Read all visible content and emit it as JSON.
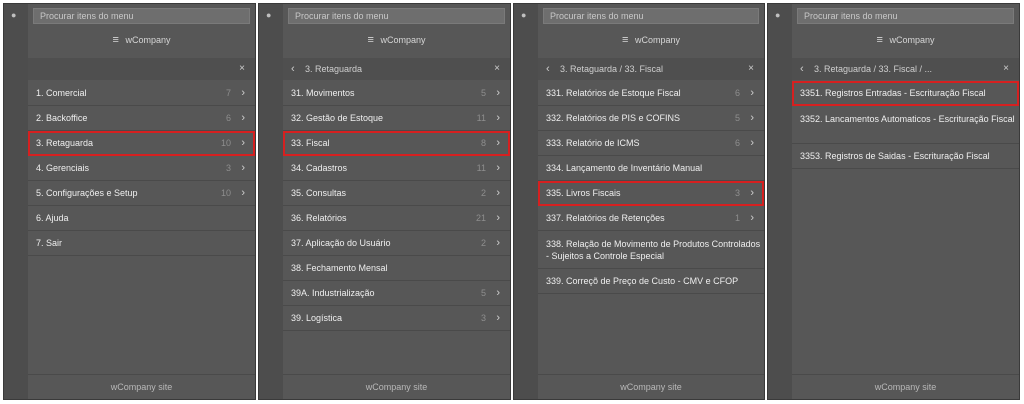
{
  "panels": [
    {
      "search_placeholder": "Procurar itens do menu",
      "title": "wCompany",
      "breadcrumb": "",
      "items": [
        {
          "label": "1. Comercial",
          "count": "7",
          "has_arrow": true
        },
        {
          "label": "2. Backoffice",
          "count": "6",
          "has_arrow": true
        },
        {
          "label": "3. Retaguarda",
          "count": "10",
          "has_arrow": true,
          "highlighted": true
        },
        {
          "label": "4. Gerenciais",
          "count": "3",
          "has_arrow": true
        },
        {
          "label": "5. Configurações e Setup",
          "count": "10",
          "has_arrow": true
        },
        {
          "label": "6. Ajuda",
          "count": "",
          "has_arrow": false
        },
        {
          "label": "7. Sair",
          "count": "",
          "has_arrow": false
        }
      ],
      "footer": "wCompany site"
    },
    {
      "search_placeholder": "Procurar itens do menu",
      "title": "wCompany",
      "breadcrumb": "3. Retaguarda",
      "items": [
        {
          "label": "31. Movimentos",
          "count": "5",
          "has_arrow": true
        },
        {
          "label": "32. Gestão de Estoque",
          "count": "11",
          "has_arrow": true
        },
        {
          "label": "33. Fiscal",
          "count": "8",
          "has_arrow": true,
          "highlighted": true
        },
        {
          "label": "34. Cadastros",
          "count": "11",
          "has_arrow": true
        },
        {
          "label": "35. Consultas",
          "count": "2",
          "has_arrow": true
        },
        {
          "label": "36. Relatórios",
          "count": "21",
          "has_arrow": true
        },
        {
          "label": "37. Aplicação do Usuário",
          "count": "2",
          "has_arrow": true
        },
        {
          "label": "38. Fechamento Mensal",
          "count": "",
          "has_arrow": false
        },
        {
          "label": "39A. Industrialização",
          "count": "5",
          "has_arrow": true
        },
        {
          "label": "39. Logística",
          "count": "3",
          "has_arrow": true
        }
      ],
      "footer": "wCompany site"
    },
    {
      "search_placeholder": "Procurar itens do menu",
      "title": "wCompany",
      "breadcrumb": "3. Retaguarda / 33. Fiscal",
      "items": [
        {
          "label": "331. Relatórios de Estoque Fiscal",
          "count": "6",
          "has_arrow": true
        },
        {
          "label": "332. Relatórios de PIS e COFINS",
          "count": "5",
          "has_arrow": true
        },
        {
          "label": "333. Relatório de ICMS",
          "count": "6",
          "has_arrow": true
        },
        {
          "label": "334. Lançamento de Inventário Manual",
          "count": "",
          "has_arrow": false
        },
        {
          "label": "335. Livros Fiscais",
          "count": "3",
          "has_arrow": true,
          "highlighted": true
        },
        {
          "label": "337. Relatórios de Retenções",
          "count": "1",
          "has_arrow": true
        },
        {
          "label": "338. Relação de Movimento de Produtos Controlados - Sujeitos a Controle Especial",
          "count": "",
          "has_arrow": false,
          "two_line": true
        },
        {
          "label": "339. Correçõ de Preço de Custo - CMV e CFOP",
          "count": "",
          "has_arrow": false
        }
      ],
      "footer": "wCompany site"
    },
    {
      "search_placeholder": "Procurar itens do menu",
      "title": "wCompany",
      "breadcrumb": "3. Retaguarda / 33. Fiscal / ...",
      "items": [
        {
          "label": "3351. Registros Entradas - Escrituração Fiscal",
          "count": "",
          "has_arrow": false,
          "highlighted": true
        },
        {
          "label": "3352. Lancamentos Automaticos - Escrituração Fiscal",
          "count": "",
          "has_arrow": false,
          "two_line": true
        },
        {
          "label": "3353. Registros de Saidas - Escrituração Fiscal",
          "count": "",
          "has_arrow": false
        }
      ],
      "footer": "wCompany site"
    }
  ]
}
